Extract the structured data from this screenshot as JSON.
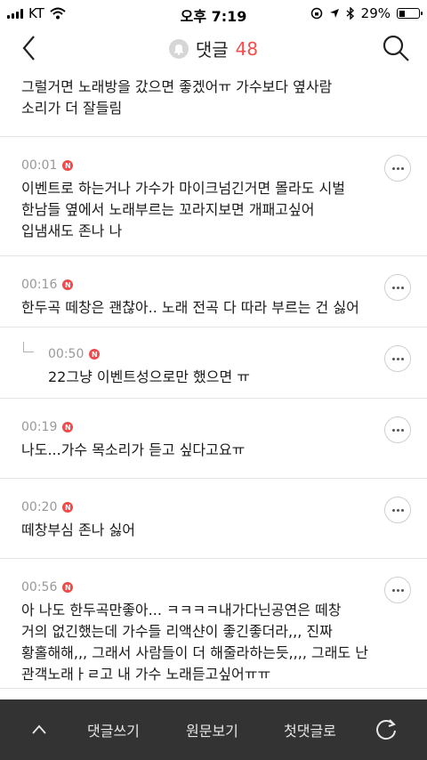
{
  "status_bar": {
    "carrier": "KT",
    "time": "오후 7:19",
    "battery": "29%"
  },
  "header": {
    "title": "댓글",
    "count": "48",
    "icons": {
      "back": "chevron-left-icon",
      "bell": "bell-icon",
      "search": "search-icon"
    }
  },
  "comments": [
    {
      "text": "그럴거면 노래방을 갔으면 좋겠어ㅠ 가수보다 옆사람\n소리가 더 잘들림"
    },
    {
      "time": "00:01",
      "badge": "N",
      "text": "이벤트로 하는거나 가수가 마이크넘긴거면 몰라도 시벌\n한남들 옆에서 노래부르는 꼬라지보면 개패고싶어\n입냄새도 존나 나"
    },
    {
      "time": "00:16",
      "badge": "N",
      "text": "한두곡 떼창은 괜찮아.. 노래 전곡 다 따라 부르는 건 싫어"
    },
    {
      "time": "00:50",
      "badge": "N",
      "text": "22그냥 이벤트성으로만 했으면 ㅠ",
      "reply": true
    },
    {
      "time": "00:19",
      "badge": "N",
      "text": "나도...가수 목소리가 듣고 싶다고요ㅠ"
    },
    {
      "time": "00:20",
      "badge": "N",
      "text": "떼창부심 존나 싫어"
    },
    {
      "time": "00:56",
      "badge": "N",
      "text": "아 나도 한두곡만좋아... ㅋㅋㅋㅋ내가다닌공연은 떼창\n거의 없긴했는데 가수들 리액샨이 좋긴좋더라,,, 진짜\n황홀해해,,, 그래서 사람들이 더 해줄라하는듯,,,, 그래도 난\n관객노래ㅏㄹ고 내 가수 노래듣고싶어ㅠㅠ"
    }
  ],
  "bottom_bar": {
    "write": "댓글쓰기",
    "original": "원문보기",
    "first": "첫댓글로"
  },
  "colors": {
    "accent": "#f44c4c",
    "bar": "#333333"
  }
}
